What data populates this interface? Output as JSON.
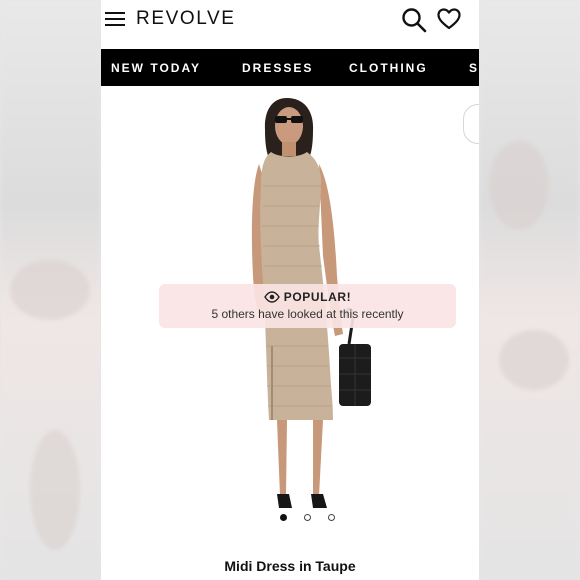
{
  "header": {
    "logo": "REVOLVE",
    "menu_icon": "hamburger-menu-icon",
    "search_icon": "search-icon",
    "wishlist_icon": "heart-icon"
  },
  "nav": {
    "items": [
      {
        "label": "NEW TODAY"
      },
      {
        "label": "DRESSES"
      },
      {
        "label": "CLOTHING"
      },
      {
        "label": "S"
      }
    ]
  },
  "product": {
    "banner_title": "POPULAR!",
    "banner_text": "5 others have looked at this recently",
    "title": "Midi Dress in Taupe",
    "image_count": 3,
    "active_image": 1
  },
  "colors": {
    "nav_bg": "#000000",
    "banner_bg": "#fae4e4",
    "dress": "#c8b39a"
  }
}
